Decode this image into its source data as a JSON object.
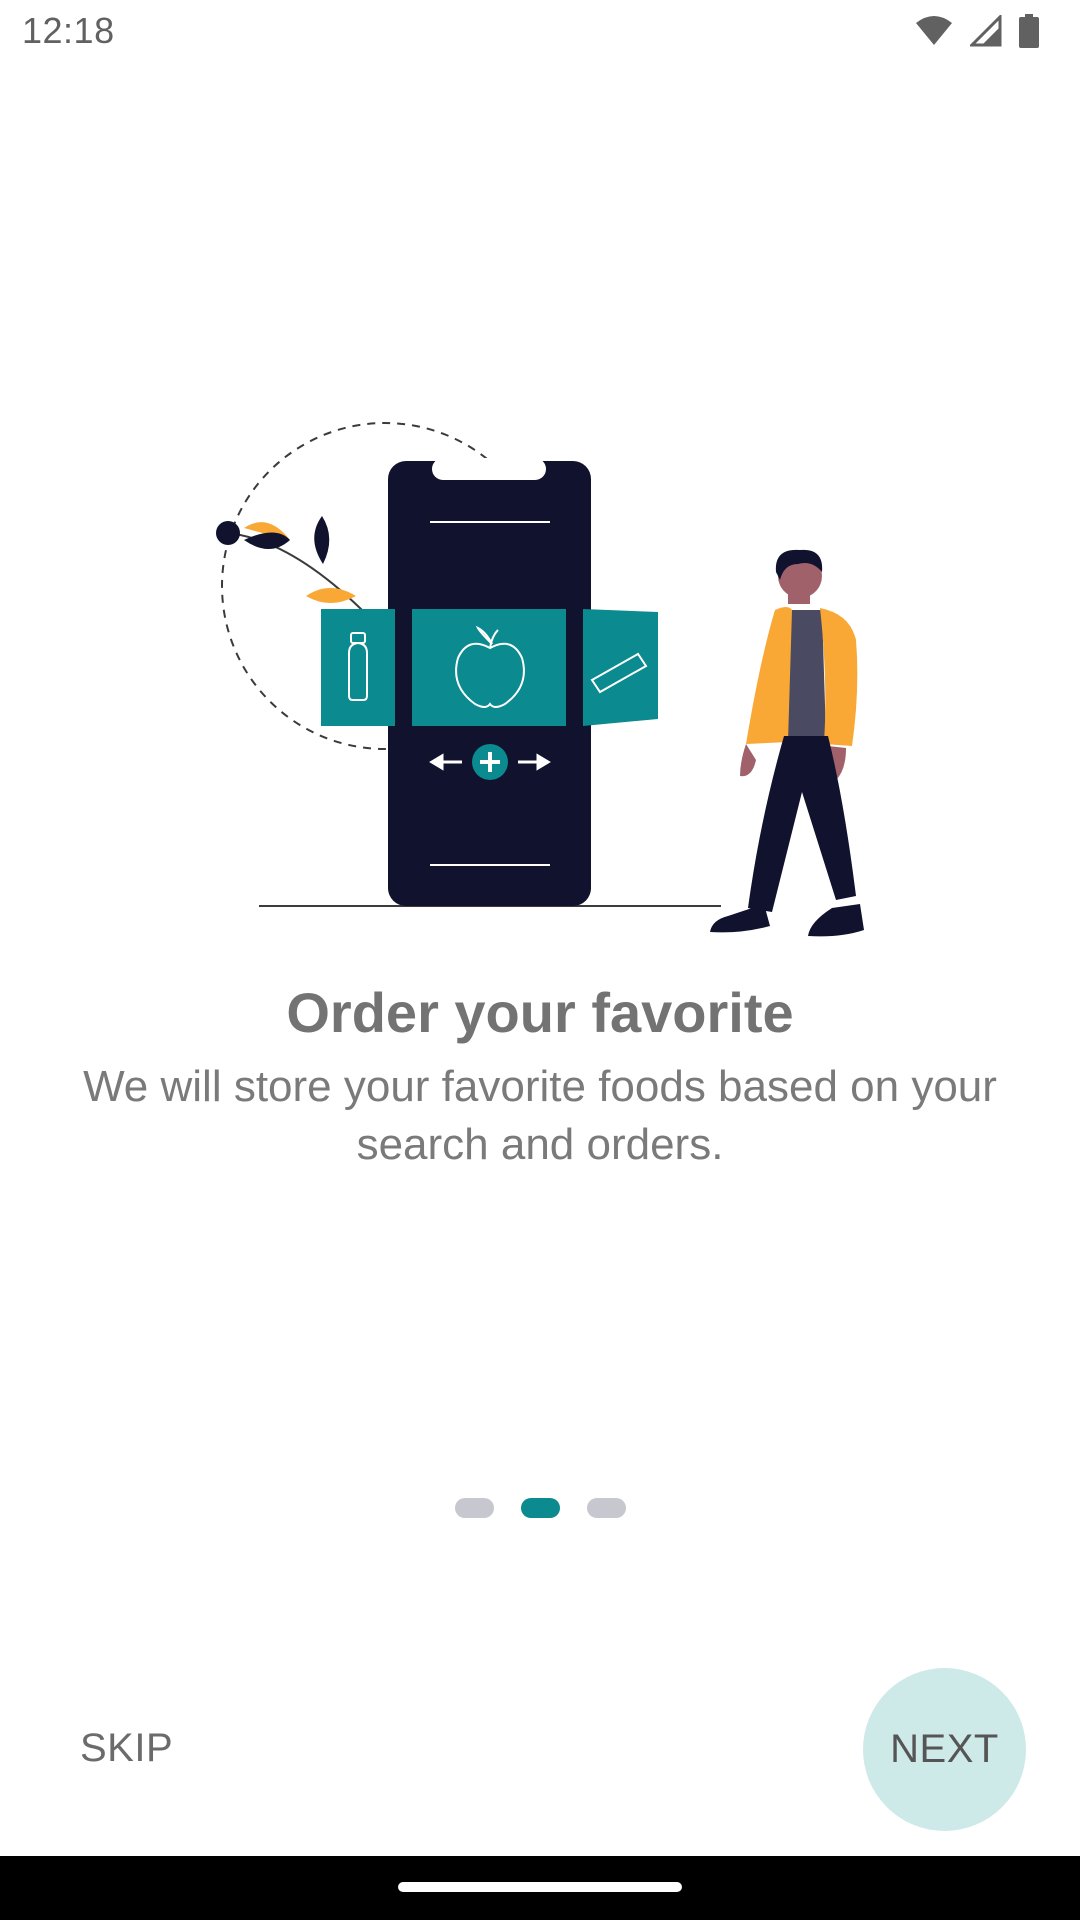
{
  "status_bar": {
    "time": "12:18",
    "icons": [
      "wifi-icon",
      "cell-signal-icon",
      "battery-icon"
    ]
  },
  "illustration": {
    "description_icons": [
      "phone-icon",
      "bottle-icon",
      "apple-icon",
      "bar-icon",
      "plus-icon",
      "person-icon",
      "plant-icon"
    ],
    "colors": {
      "phone": "#11122d",
      "teal": "#0b8a8f",
      "accent": "#f9a836",
      "skin": "#a0616a"
    }
  },
  "onboarding": {
    "title": "Order your favorite",
    "description": "We will store your favorite foods based on your search and orders."
  },
  "page_indicator": {
    "total": 3,
    "active_index": 1,
    "colors": {
      "active": "#0b8a8f",
      "inactive": "#c7c7cf"
    }
  },
  "actions": {
    "skip_label": "SKIP",
    "next_label": "NEXT"
  }
}
